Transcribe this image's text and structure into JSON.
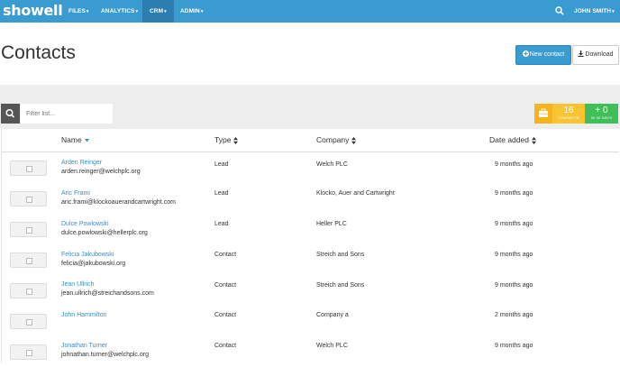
{
  "nav": {
    "logo": "showell",
    "items": [
      {
        "label": "FILES"
      },
      {
        "label": "ANALYTICS"
      },
      {
        "label": "CRM"
      },
      {
        "label": "ADMIN"
      }
    ],
    "user": "JOHN SMITH",
    "icons": {
      "search": "search-icon",
      "caret": "caret-down-icon"
    }
  },
  "header": {
    "title": "Contacts",
    "new_contact_label": "New contact",
    "download_label": "Download"
  },
  "filter": {
    "placeholder": "Filter list..."
  },
  "stats": {
    "contacts_count": "16",
    "contacts_label": "CONTACTS",
    "new_count": "+ 0",
    "new_label": "IN 30 DAYS",
    "colors": {
      "contacts": "#f8c431",
      "new": "#3fbe5a",
      "icon": "#f5b41a"
    }
  },
  "table": {
    "columns": {
      "name": "Name",
      "type": "Type",
      "company": "Company",
      "date_added": "Date added"
    },
    "rows": [
      {
        "name": "Arden Reinger",
        "email": "arden.reinger@welchplc.org",
        "type": "Lead",
        "company": "Welch PLC",
        "date": "9 months ago"
      },
      {
        "name": "Aric Frami",
        "email": "aric.frami@klockoauerandcartwright.com",
        "type": "Lead",
        "company": "Klocko, Auer and Cartwright",
        "date": "9 months ago"
      },
      {
        "name": "Dulce Powlowski",
        "email": "dulce.powlowski@hellerplc.org",
        "type": "Lead",
        "company": "Heller PLC",
        "date": "9 months ago"
      },
      {
        "name": "Felicia Jakubowski",
        "email": "felicia@jakubowski.org",
        "type": "Contact",
        "company": "Streich and Sons",
        "date": "9 months ago"
      },
      {
        "name": "Jean Ullrich",
        "email": "jean.ullrich@streichandsons.com",
        "type": "Contact",
        "company": "Streich and Sons",
        "date": "9 months ago"
      },
      {
        "name": "John Hammilton",
        "email": "",
        "type": "Contact",
        "company": "Company a",
        "date": "2 months ago"
      },
      {
        "name": "Jonathan Turner",
        "email": "johnathan.turner@welchplc.org",
        "type": "Contact",
        "company": "Welch PLC",
        "date": "9 months ago"
      }
    ]
  },
  "colors": {
    "brand": "#3a9bd1",
    "link": "#3a8dc6"
  }
}
